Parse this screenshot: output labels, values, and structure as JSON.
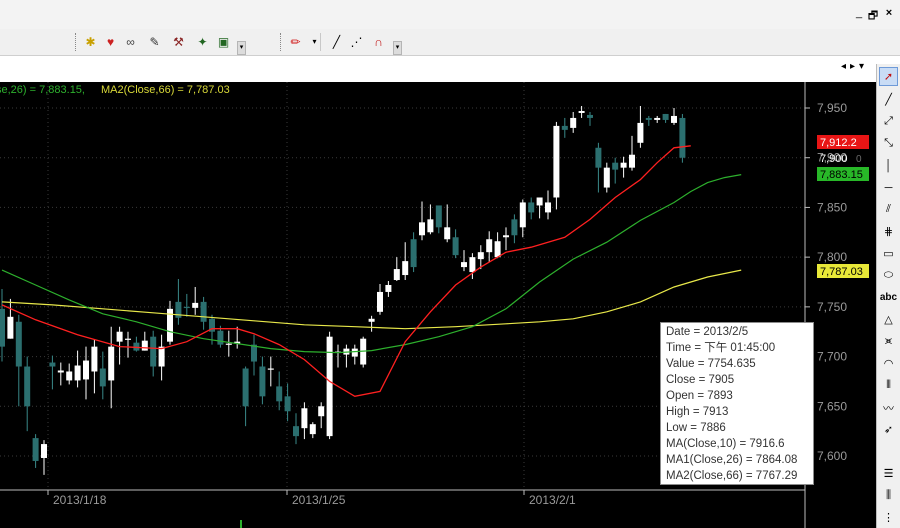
{
  "window": {
    "restore_label": "🗗",
    "close_label": "×"
  },
  "legend": {
    "ma1_text": "se,26) = 7,883.15,",
    "ma2_text": "MA2(Close,66) = 7,787.03",
    "ma1_color": "#2db02d",
    "ma2_color": "#d8d838"
  },
  "colors": {
    "up": "#ffffff",
    "down": "#2b6f6f",
    "ma_close_10": "#ff2020",
    "ma1": "#2db02d",
    "ma2": "#e8e84a",
    "grid": "#3a3a3a"
  },
  "price_labels": {
    "ma10": "7,912.2",
    "last": "7,900",
    "ma1": "7,883.15",
    "ma2": "7,787.03"
  },
  "tooltip": {
    "date": "Date = 2013/2/5",
    "time": "Time = 下午 01:45:00",
    "value": "Value = 7754.635",
    "close": "Close = 7905",
    "open": "Open = 7893",
    "high": "High = 7913",
    "low": "Low = 7886",
    "ma": "MA(Close,10) = 7916.6",
    "ma1": "MA1(Close,26) = 7864.08",
    "ma2": "MA2(Close,66) = 7767.29"
  },
  "chart_data": {
    "type": "candlestick",
    "y_ticks": [
      "7,950",
      "7,900",
      "7,850",
      "7,800",
      "7,750",
      "7,700",
      "7,650",
      "7,600"
    ],
    "ylim": [
      7580,
      7970
    ],
    "x_ticks": [
      "2013/1/18",
      "2013/1/25",
      "2013/2/1"
    ],
    "candles": [
      {
        "o": 7748,
        "c": 7710,
        "h": 7768,
        "l": 7695
      },
      {
        "o": 7718,
        "c": 7740,
        "h": 7758,
        "l": 7718
      },
      {
        "o": 7735,
        "c": 7690,
        "h": 7742,
        "l": 7650
      },
      {
        "o": 7690,
        "c": 7650,
        "h": 7700,
        "l": 7625
      },
      {
        "o": 7618,
        "c": 7595,
        "h": 7622,
        "l": 7588
      },
      {
        "o": 7598,
        "c": 7612,
        "h": 7616,
        "l": 7581
      },
      {
        "o": 7694,
        "c": 7690,
        "h": 7701,
        "l": 7667
      },
      {
        "o": 7684,
        "c": 7686,
        "h": 7694,
        "l": 7671
      },
      {
        "o": 7676,
        "c": 7685,
        "h": 7693,
        "l": 7672
      },
      {
        "o": 7676,
        "c": 7691,
        "h": 7706,
        "l": 7669
      },
      {
        "o": 7677,
        "c": 7696,
        "h": 7710,
        "l": 7657
      },
      {
        "o": 7685,
        "c": 7710,
        "h": 7717,
        "l": 7663
      },
      {
        "o": 7688,
        "c": 7670,
        "h": 7705,
        "l": 7657
      },
      {
        "o": 7676,
        "c": 7710,
        "h": 7730,
        "l": 7648
      },
      {
        "o": 7715,
        "c": 7725,
        "h": 7730,
        "l": 7692
      },
      {
        "o": 7717,
        "c": 7718,
        "h": 7725,
        "l": 7699
      },
      {
        "o": 7714,
        "c": 7706,
        "h": 7720,
        "l": 7705
      },
      {
        "o": 7706,
        "c": 7716,
        "h": 7725,
        "l": 7706
      },
      {
        "o": 7720,
        "c": 7690,
        "h": 7726,
        "l": 7680
      },
      {
        "o": 7690,
        "c": 7710,
        "h": 7722,
        "l": 7676
      },
      {
        "o": 7715,
        "c": 7748,
        "h": 7756,
        "l": 7712
      },
      {
        "o": 7755,
        "c": 7739,
        "h": 7778,
        "l": 7732
      },
      {
        "o": 7750,
        "c": 7749,
        "h": 7763,
        "l": 7740
      },
      {
        "o": 7749,
        "c": 7754,
        "h": 7770,
        "l": 7742
      },
      {
        "o": 7755,
        "c": 7735,
        "h": 7760,
        "l": 7727
      },
      {
        "o": 7738,
        "c": 7725,
        "h": 7742,
        "l": 7712
      },
      {
        "o": 7726,
        "c": 7712,
        "h": 7731,
        "l": 7709
      },
      {
        "o": 7713,
        "c": 7713,
        "h": 7726,
        "l": 7700
      },
      {
        "o": 7713,
        "c": 7715,
        "h": 7730,
        "l": 7708
      },
      {
        "o": 7688,
        "c": 7650,
        "h": 7690,
        "l": 7630
      },
      {
        "o": 7712,
        "c": 7695,
        "h": 7722,
        "l": 7681
      },
      {
        "o": 7690,
        "c": 7660,
        "h": 7700,
        "l": 7652
      },
      {
        "o": 7688,
        "c": 7688,
        "h": 7700,
        "l": 7670
      },
      {
        "o": 7670,
        "c": 7655,
        "h": 7685,
        "l": 7646
      },
      {
        "o": 7660,
        "c": 7645,
        "h": 7673,
        "l": 7635
      },
      {
        "o": 7630,
        "c": 7620,
        "h": 7643,
        "l": 7612
      },
      {
        "o": 7628,
        "c": 7648,
        "h": 7654,
        "l": 7617
      },
      {
        "o": 7622,
        "c": 7632,
        "h": 7634,
        "l": 7618
      },
      {
        "o": 7640,
        "c": 7650,
        "h": 7654,
        "l": 7628
      },
      {
        "o": 7620,
        "c": 7720,
        "h": 7725,
        "l": 7617
      },
      {
        "o": 7705,
        "c": 7705,
        "h": 7712,
        "l": 7689
      },
      {
        "o": 7702,
        "c": 7708,
        "h": 7712,
        "l": 7689
      },
      {
        "o": 7700,
        "c": 7708,
        "h": 7712,
        "l": 7692
      },
      {
        "o": 7692,
        "c": 7718,
        "h": 7720,
        "l": 7689
      },
      {
        "o": 7735,
        "c": 7738,
        "h": 7741,
        "l": 7725
      },
      {
        "o": 7745,
        "c": 7765,
        "h": 7773,
        "l": 7742
      },
      {
        "o": 7765,
        "c": 7772,
        "h": 7776,
        "l": 7760
      },
      {
        "o": 7777,
        "c": 7788,
        "h": 7800,
        "l": 7776
      },
      {
        "o": 7782,
        "c": 7796,
        "h": 7815,
        "l": 7777
      },
      {
        "o": 7818,
        "c": 7790,
        "h": 7825,
        "l": 7785
      },
      {
        "o": 7822,
        "c": 7835,
        "h": 7856,
        "l": 7817
      },
      {
        "o": 7825,
        "c": 7838,
        "h": 7853,
        "l": 7823
      },
      {
        "o": 7852,
        "c": 7830,
        "h": 7850,
        "l": 7824
      },
      {
        "o": 7818,
        "c": 7830,
        "h": 7853,
        "l": 7815
      },
      {
        "o": 7820,
        "c": 7802,
        "h": 7828,
        "l": 7799
      },
      {
        "o": 7790,
        "c": 7795,
        "h": 7807,
        "l": 7786
      },
      {
        "o": 7785,
        "c": 7800,
        "h": 7804,
        "l": 7778
      },
      {
        "o": 7798,
        "c": 7805,
        "h": 7812,
        "l": 7788
      },
      {
        "o": 7805,
        "c": 7818,
        "h": 7826,
        "l": 7795
      },
      {
        "o": 7800,
        "c": 7816,
        "h": 7825,
        "l": 7799
      },
      {
        "o": 7820,
        "c": 7822,
        "h": 7830,
        "l": 7807
      },
      {
        "o": 7838,
        "c": 7822,
        "h": 7843,
        "l": 7814
      },
      {
        "o": 7830,
        "c": 7855,
        "h": 7858,
        "l": 7820
      },
      {
        "o": 7855,
        "c": 7845,
        "h": 7860,
        "l": 7838
      },
      {
        "o": 7852,
        "c": 7860,
        "h": 7860,
        "l": 7839
      },
      {
        "o": 7845,
        "c": 7855,
        "h": 7867,
        "l": 7838
      },
      {
        "o": 7860,
        "c": 7932,
        "h": 7936,
        "l": 7848
      },
      {
        "o": 7932,
        "c": 7928,
        "h": 7940,
        "l": 7920
      },
      {
        "o": 7930,
        "c": 7940,
        "h": 7946,
        "l": 7925
      },
      {
        "o": 7945,
        "c": 7947,
        "h": 7952,
        "l": 7940
      },
      {
        "o": 7943,
        "c": 7940,
        "h": 7946,
        "l": 7932
      },
      {
        "o": 7910,
        "c": 7890,
        "h": 7915,
        "l": 7865
      },
      {
        "o": 7870,
        "c": 7890,
        "h": 7895,
        "l": 7865
      },
      {
        "o": 7895,
        "c": 7888,
        "h": 7900,
        "l": 7874
      },
      {
        "o": 7890,
        "c": 7895,
        "h": 7901,
        "l": 7880
      },
      {
        "o": 7890,
        "c": 7903,
        "h": 7922,
        "l": 7887
      },
      {
        "o": 7915,
        "c": 7935,
        "h": 7952,
        "l": 7910
      },
      {
        "o": 7940,
        "c": 7938,
        "h": 7942,
        "l": 7932
      },
      {
        "o": 7938,
        "c": 7940,
        "h": 7942,
        "l": 7935
      },
      {
        "o": 7944,
        "c": 7938,
        "h": 7944,
        "l": 7935
      },
      {
        "o": 7935,
        "c": 7942,
        "h": 7950,
        "l": 7933
      },
      {
        "o": 7940,
        "c": 7900,
        "h": 7944,
        "l": 7895
      }
    ],
    "ma_close_10": [
      [
        0,
        7752
      ],
      [
        4,
        7737
      ],
      [
        9,
        7722
      ],
      [
        14,
        7710
      ],
      [
        19,
        7708
      ],
      [
        22,
        7715
      ],
      [
        25,
        7728
      ],
      [
        28,
        7728
      ],
      [
        30,
        7723
      ],
      [
        33,
        7712
      ],
      [
        36,
        7697
      ],
      [
        39,
        7675
      ],
      [
        42,
        7660
      ],
      [
        45,
        7665
      ],
      [
        48,
        7715
      ],
      [
        51,
        7745
      ],
      [
        54,
        7772
      ],
      [
        57,
        7790
      ],
      [
        60,
        7805
      ],
      [
        63,
        7810
      ],
      [
        67,
        7820
      ],
      [
        70,
        7838
      ],
      [
        73,
        7860
      ],
      [
        76,
        7878
      ],
      [
        78,
        7895
      ],
      [
        80,
        7910
      ],
      [
        82,
        7912
      ]
    ],
    "ma1": [
      [
        0,
        7787
      ],
      [
        4,
        7772
      ],
      [
        8,
        7757
      ],
      [
        12,
        7743
      ],
      [
        16,
        7735
      ],
      [
        20,
        7725
      ],
      [
        24,
        7718
      ],
      [
        28,
        7713
      ],
      [
        32,
        7708
      ],
      [
        36,
        7705
      ],
      [
        40,
        7704
      ],
      [
        44,
        7706
      ],
      [
        48,
        7712
      ],
      [
        52,
        7720
      ],
      [
        56,
        7730
      ],
      [
        60,
        7748
      ],
      [
        64,
        7775
      ],
      [
        68,
        7798
      ],
      [
        72,
        7815
      ],
      [
        76,
        7837
      ],
      [
        80,
        7855
      ],
      [
        82,
        7866
      ],
      [
        84,
        7875
      ],
      [
        86,
        7880
      ],
      [
        88,
        7883
      ]
    ],
    "ma2": [
      [
        0,
        7755
      ],
      [
        6,
        7752
      ],
      [
        12,
        7748
      ],
      [
        18,
        7744
      ],
      [
        24,
        7740
      ],
      [
        30,
        7736
      ],
      [
        36,
        7732
      ],
      [
        42,
        7730
      ],
      [
        48,
        7728
      ],
      [
        54,
        7730
      ],
      [
        60,
        7733
      ],
      [
        64,
        7735
      ],
      [
        68,
        7738
      ],
      [
        72,
        7745
      ],
      [
        76,
        7755
      ],
      [
        80,
        7770
      ],
      [
        84,
        7780
      ],
      [
        88,
        7787
      ]
    ]
  }
}
